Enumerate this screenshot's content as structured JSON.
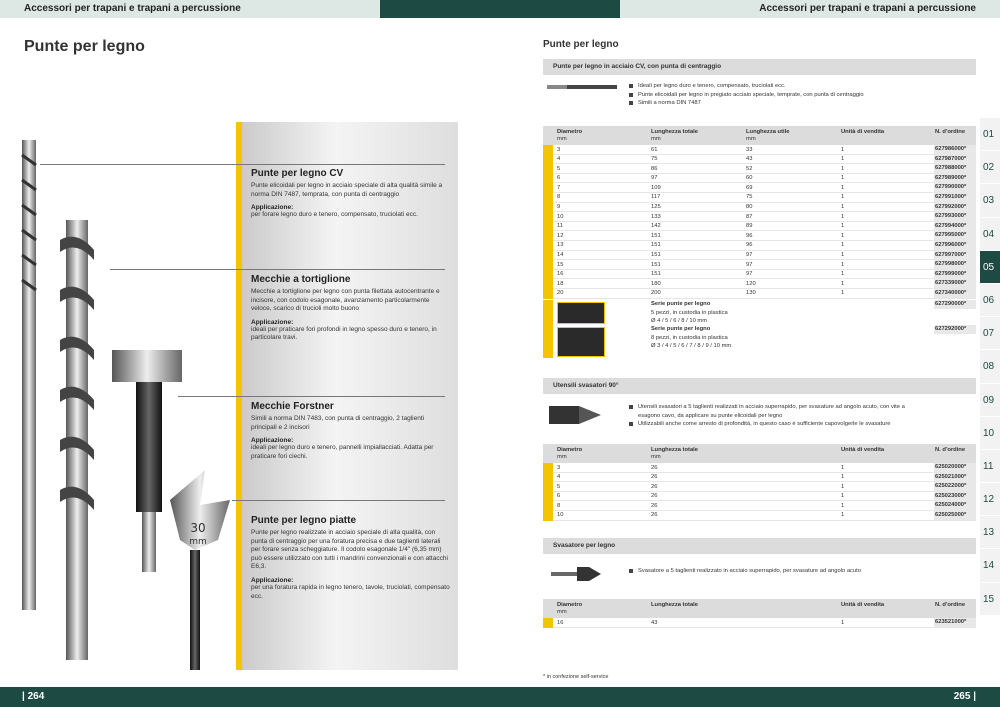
{
  "header": {
    "left": "Accessori per trapani e trapani a percussione",
    "right": "Accessori per trapani e trapani a percussione"
  },
  "footer": {
    "left": "| 264",
    "right": "265 |"
  },
  "left": {
    "title": "Punte per legno",
    "tool_label_30": "30",
    "tool_label_mm": "mm",
    "products": [
      {
        "title": "Punte per legno CV",
        "desc": "Punte elicoidali per legno in acciaio speciale di alta qualità simile a norma DIN 7487, temprata, con punta di centraggio",
        "app_label": "Applicazione:",
        "app": "per forare legno duro e tenero, compensato, truciolati ecc."
      },
      {
        "title": "Mecchie a tortiglione",
        "desc": "Mecchie a tortiglione per legno con punta filettata autocentrante e incisore, con codolo esagonale, avanzamento particolarmente veloce, scarico di trucioli molto buono",
        "app_label": "Applicazione:",
        "app": "ideali per praticare fori profondi in legno spesso duro e tenero, in particolare travi."
      },
      {
        "title": "Mecchie Forstner",
        "desc": "Simili a norma DIN 7483, con punta di centraggio, 2 taglienti principali e 2 incisori",
        "app_label": "Applicazione:",
        "app": "ideali per legno duro e tenero, pannelli impiallacciati. Adatta per praticare fori ciechi."
      },
      {
        "title": "Punte per legno piatte",
        "desc": "Punte per legno realizzate in acciaio speciale di alta qualità, con punta di centraggio per una foratura precisa e due taglienti laterali per forare senza scheggiature. Il codolo esagonale 1/4\" (6,35 mm) può essere utilizzato con tutti i mandrini convenzionali e con attacchi E6,3.",
        "app_label": "Applicazione:",
        "app": "per una foratura rapida in legno tenero, tavole, truciolati, compensato ecc."
      }
    ]
  },
  "right": {
    "title": "Punte per legno",
    "sec1": {
      "title": "Punte per legno in acciaio CV, con punta di centraggio",
      "bullets": [
        "Ideali per legno duro e tenero, compensato, truciolati ecc.",
        "Punte elicoidali per legno in pregiato acciaio speciale, temprate, con punta di centraggio",
        "Simili a norma DIN 7487"
      ],
      "headers": [
        "Diametro",
        "Lunghezza totale",
        "Lunghezza utile",
        "Unità di vendita",
        "N. d'ordine"
      ],
      "unit": "mm",
      "rows": [
        [
          "3",
          "61",
          "33",
          "1",
          "627986000*"
        ],
        [
          "4",
          "75",
          "43",
          "1",
          "627987000*"
        ],
        [
          "5",
          "86",
          "52",
          "1",
          "627988000*"
        ],
        [
          "6",
          "97",
          "60",
          "1",
          "627989000*"
        ],
        [
          "7",
          "109",
          "69",
          "1",
          "627990000*"
        ],
        [
          "8",
          "117",
          "75",
          "1",
          "627991000*"
        ],
        [
          "9",
          "125",
          "80",
          "1",
          "627992000*"
        ],
        [
          "10",
          "133",
          "87",
          "1",
          "627993000*"
        ],
        [
          "11",
          "142",
          "89",
          "1",
          "627994000*"
        ],
        [
          "12",
          "151",
          "96",
          "1",
          "627995000*"
        ],
        [
          "13",
          "151",
          "96",
          "1",
          "627996000*"
        ],
        [
          "14",
          "151",
          "97",
          "1",
          "627997000*"
        ],
        [
          "15",
          "151",
          "97",
          "1",
          "627998000*"
        ],
        [
          "16",
          "151",
          "97",
          "1",
          "627999000*"
        ],
        [
          "18",
          "180",
          "120",
          "1",
          "627339000*"
        ],
        [
          "20",
          "200",
          "130",
          "1",
          "627340000*"
        ]
      ],
      "sets": [
        {
          "name": "Serie punte per legno",
          "l1": "5 pezzi, in custodia in plastica",
          "l2": "Ø 4 / 5 / 6 / 8 / 10 mm",
          "ord": "627290000*"
        },
        {
          "name": "Serie punte per legno",
          "l1": "8 pezzi, in custodia in plastica",
          "l2": "Ø 3 / 4 / 5 / 6 / 7 / 8 / 9 / 10 mm",
          "ord": "627292000*"
        }
      ]
    },
    "sec2": {
      "title": "Utensili svasatori 90°",
      "bullets": [
        "Utensili svasatori a 5 taglienti realizzati in acciaio superrapido, per svasature ad angolo acuto, con vite a esagono cavo, da applicare su punte elicoidali per legno",
        "Utilizzabili anche come arresto di profondità, in questo caso è sufficiente capovolgerle le svasature"
      ],
      "headers": [
        "Diametro",
        "Lunghezza totale",
        "Unità di vendita",
        "N. d'ordine"
      ],
      "unit": "mm",
      "rows": [
        [
          "3",
          "26",
          "1",
          "625020000*"
        ],
        [
          "4",
          "26",
          "1",
          "625021000*"
        ],
        [
          "5",
          "26",
          "1",
          "625022000*"
        ],
        [
          "6",
          "26",
          "1",
          "625023000*"
        ],
        [
          "8",
          "26",
          "1",
          "625024000*"
        ],
        [
          "10",
          "26",
          "1",
          "625025000*"
        ]
      ]
    },
    "sec3": {
      "title": "Svasatore per legno",
      "bullets": [
        "Svasatore a 5 taglienti realizzato in acciaio superrapido, per svasature ad angolo acuto"
      ],
      "headers": [
        "Diametro",
        "Lunghezza totale",
        "Unità di vendita",
        "N. d'ordine"
      ],
      "unit": "mm",
      "rows": [
        [
          "16",
          "43",
          "1",
          "623521000*"
        ]
      ]
    },
    "footnote": "* in confezione self-service",
    "chapters": [
      "01",
      "02",
      "03",
      "04",
      "05",
      "06",
      "07",
      "08",
      "09",
      "10",
      "11",
      "12",
      "13",
      "14",
      "15"
    ],
    "active_chapter": "05"
  }
}
